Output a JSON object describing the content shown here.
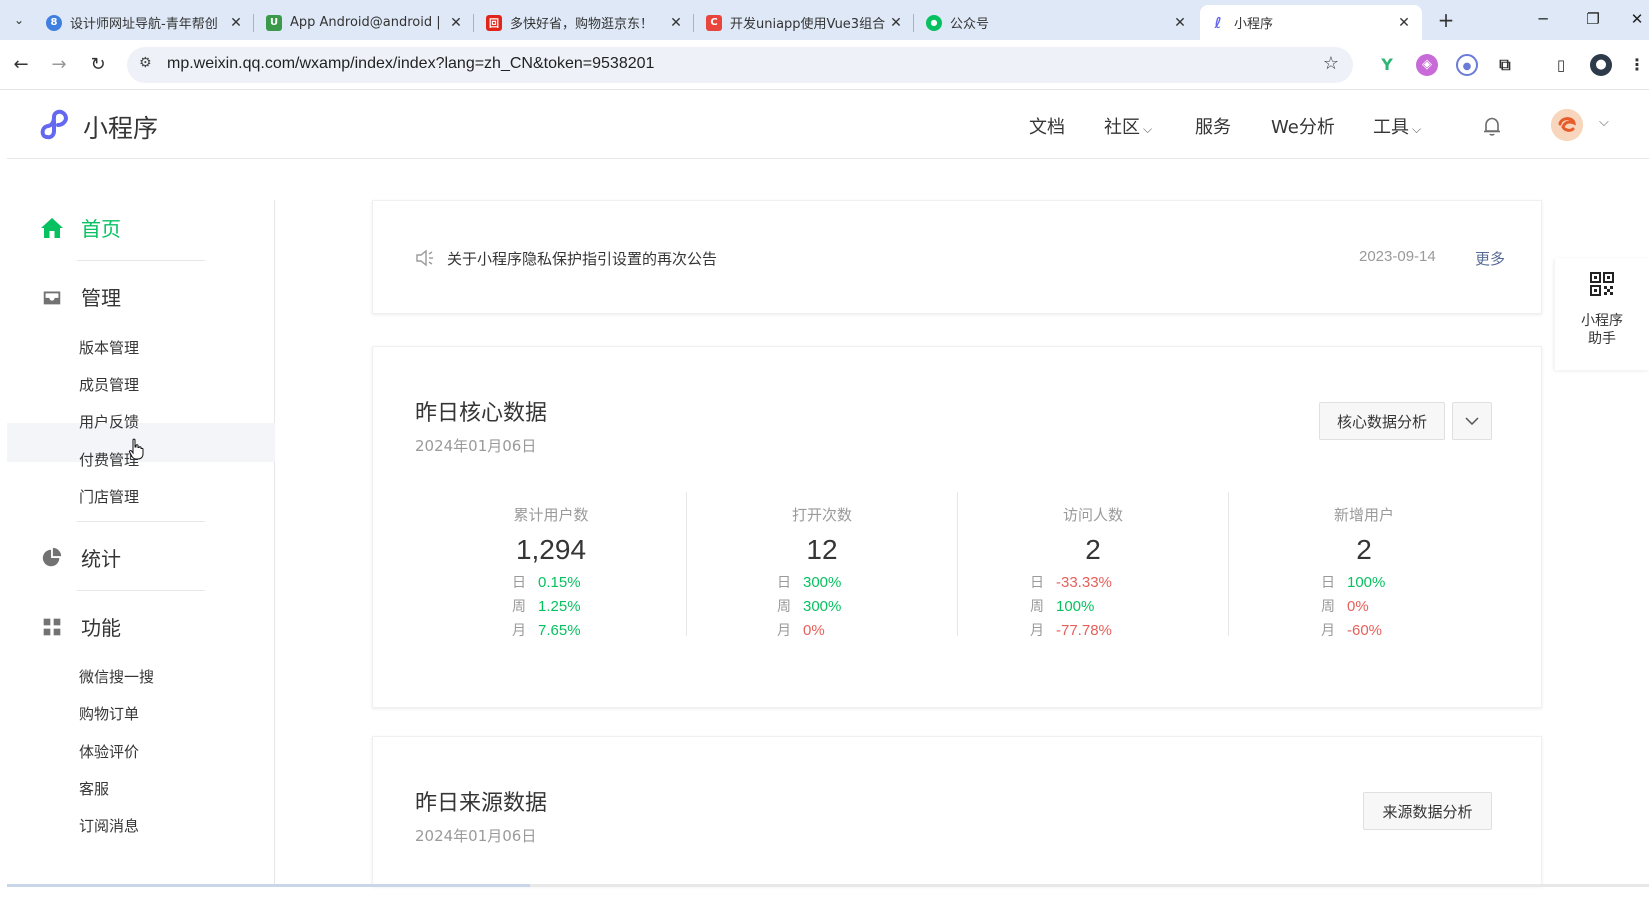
{
  "browser": {
    "tabs": [
      {
        "title": "设计师网址导航-青年帮创",
        "favicon_color": "#3f7fe0",
        "favicon_glyph": "8"
      },
      {
        "title": "App Android@android |",
        "favicon_color": "#3a9a4a",
        "favicon_glyph": "U"
      },
      {
        "title": "多快好省，购物逛京东！",
        "favicon_color": "#e1251b",
        "favicon_glyph": "回"
      },
      {
        "title": "开发uniapp使用Vue3组合",
        "favicon_color": "#e8453c",
        "favicon_glyph": "C"
      },
      {
        "title": "公众号",
        "favicon_color": "#07c160",
        "favicon_glyph": "●"
      },
      {
        "title": "小程序",
        "favicon_color": "#6467f0",
        "favicon_glyph": "ℓ"
      }
    ],
    "url": "mp.weixin.qq.com/wxamp/index/index?lang=zh_CN&token=9538201"
  },
  "header": {
    "logo_text": "小程序",
    "nav": [
      {
        "label": "文档"
      },
      {
        "label": "社区",
        "has_caret": true
      },
      {
        "label": "服务"
      },
      {
        "label": "We分析"
      },
      {
        "label": "工具",
        "has_caret": true
      }
    ]
  },
  "sidebar": {
    "groups": [
      {
        "label": "首页",
        "icon": "home-icon",
        "active": true
      },
      {
        "label": "管理",
        "icon": "inbox-icon",
        "items": [
          "版本管理",
          "成员管理",
          "用户反馈",
          "付费管理",
          "门店管理"
        ]
      },
      {
        "label": "统计",
        "icon": "pie-chart-icon"
      },
      {
        "label": "功能",
        "icon": "grid-icon",
        "items": [
          "微信搜一搜",
          "购物订单",
          "体验评价",
          "客服",
          "订阅消息"
        ]
      }
    ],
    "hovered_item": "用户反馈"
  },
  "notice": {
    "text": "关于小程序隐私保护指引设置的再次公告",
    "date": "2023-09-14",
    "more": "更多"
  },
  "core": {
    "title": "昨日核心数据",
    "date": "2024年01月06日",
    "analyze_button": "核心数据分析",
    "period_labels": [
      "日",
      "周",
      "月"
    ],
    "metrics": [
      {
        "label": "累计用户数",
        "value": "1,294",
        "changes": [
          {
            "v": "0.15%",
            "dir": "up"
          },
          {
            "v": "1.25%",
            "dir": "up"
          },
          {
            "v": "7.65%",
            "dir": "up"
          }
        ]
      },
      {
        "label": "打开次数",
        "value": "12",
        "changes": [
          {
            "v": "300%",
            "dir": "up"
          },
          {
            "v": "300%",
            "dir": "up"
          },
          {
            "v": "0%",
            "dir": "down"
          }
        ]
      },
      {
        "label": "访问人数",
        "value": "2",
        "changes": [
          {
            "v": "-33.33%",
            "dir": "down"
          },
          {
            "v": "100%",
            "dir": "up"
          },
          {
            "v": "-77.78%",
            "dir": "down"
          }
        ]
      },
      {
        "label": "新增用户",
        "value": "2",
        "changes": [
          {
            "v": "100%",
            "dir": "up"
          },
          {
            "v": "0%",
            "dir": "down"
          },
          {
            "v": "-60%",
            "dir": "down"
          }
        ]
      }
    ]
  },
  "source": {
    "title": "昨日来源数据",
    "date": "2024年01月06日",
    "analyze_button": "来源数据分析"
  },
  "helper": {
    "label_line1": "小程序",
    "label_line2": "助手"
  },
  "colors": {
    "brand_green": "#07c160",
    "up": "#07c160",
    "down": "#e6605a",
    "link": "#576b95"
  }
}
